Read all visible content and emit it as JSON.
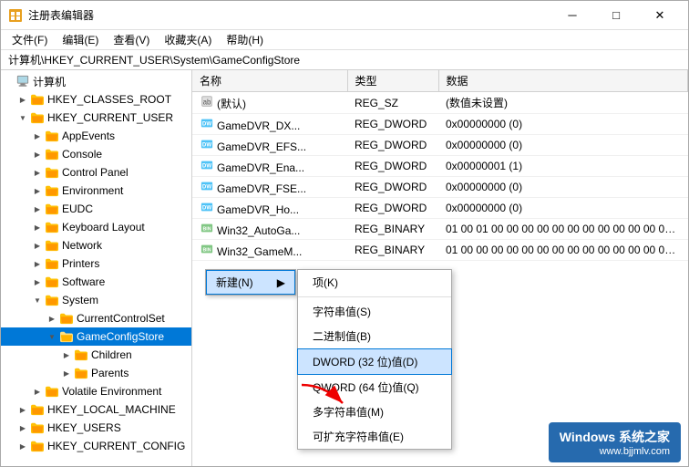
{
  "window": {
    "title": "注册表编辑器",
    "title_icon": "regedit"
  },
  "title_controls": {
    "minimize": "─",
    "maximize": "□",
    "close": "✕"
  },
  "menu_bar": {
    "items": [
      "文件(F)",
      "编辑(E)",
      "查看(V)",
      "收藏夹(A)",
      "帮助(H)"
    ]
  },
  "address_bar": {
    "path": "计算机\\HKEY_CURRENT_USER\\System\\GameConfigStore"
  },
  "tree": {
    "items": [
      {
        "label": "计算机",
        "indent": 0,
        "expanded": true,
        "toggle": ""
      },
      {
        "label": "HKEY_CLASSES_ROOT",
        "indent": 1,
        "expanded": false,
        "toggle": "▶"
      },
      {
        "label": "HKEY_CURRENT_USER",
        "indent": 1,
        "expanded": true,
        "toggle": "▼"
      },
      {
        "label": "AppEvents",
        "indent": 2,
        "expanded": false,
        "toggle": "▶"
      },
      {
        "label": "Console",
        "indent": 2,
        "expanded": false,
        "toggle": "▶"
      },
      {
        "label": "Control Panel",
        "indent": 2,
        "expanded": false,
        "toggle": "▶"
      },
      {
        "label": "Environment",
        "indent": 2,
        "expanded": false,
        "toggle": "▶"
      },
      {
        "label": "EUDC",
        "indent": 2,
        "expanded": false,
        "toggle": "▶"
      },
      {
        "label": "Keyboard Layout",
        "indent": 2,
        "expanded": false,
        "toggle": "▶"
      },
      {
        "label": "Network",
        "indent": 2,
        "expanded": false,
        "toggle": "▶"
      },
      {
        "label": "Printers",
        "indent": 2,
        "expanded": false,
        "toggle": "▶"
      },
      {
        "label": "Software",
        "indent": 2,
        "expanded": false,
        "toggle": "▶"
      },
      {
        "label": "System",
        "indent": 2,
        "expanded": true,
        "toggle": "▼"
      },
      {
        "label": "CurrentControlSet",
        "indent": 3,
        "expanded": false,
        "toggle": "▶"
      },
      {
        "label": "GameConfigStore",
        "indent": 3,
        "expanded": true,
        "toggle": "▼",
        "selected": true
      },
      {
        "label": "Children",
        "indent": 4,
        "expanded": false,
        "toggle": "▶"
      },
      {
        "label": "Parents",
        "indent": 4,
        "expanded": false,
        "toggle": "▶"
      },
      {
        "label": "Volatile Environment",
        "indent": 2,
        "expanded": false,
        "toggle": "▶"
      },
      {
        "label": "HKEY_LOCAL_MACHINE",
        "indent": 1,
        "expanded": false,
        "toggle": "▶"
      },
      {
        "label": "HKEY_USERS",
        "indent": 1,
        "expanded": false,
        "toggle": "▶"
      },
      {
        "label": "HKEY_CURRENT_CONFIG",
        "indent": 1,
        "expanded": false,
        "toggle": "▶"
      }
    ]
  },
  "table": {
    "columns": [
      "名称",
      "类型",
      "数据"
    ],
    "rows": [
      {
        "name": "(默认)",
        "icon": "default",
        "type": "REG_SZ",
        "data": "(数值未设置)"
      },
      {
        "name": "GameDVR_DX...",
        "icon": "dword",
        "type": "REG_DWORD",
        "data": "0x00000000 (0)"
      },
      {
        "name": "GameDVR_EFS...",
        "icon": "dword",
        "type": "REG_DWORD",
        "data": "0x00000000 (0)"
      },
      {
        "name": "GameDVR_Ena...",
        "icon": "dword",
        "type": "REG_DWORD",
        "data": "0x00000001 (1)"
      },
      {
        "name": "GameDVR_FSE...",
        "icon": "dword",
        "type": "REG_DWORD",
        "data": "0x00000000 (0)"
      },
      {
        "name": "GameDVR_Ho...",
        "icon": "dword",
        "type": "REG_DWORD",
        "data": "0x00000000 (0)"
      },
      {
        "name": "Win32_AutoGa...",
        "icon": "binary",
        "type": "REG_BINARY",
        "data": "01 00 01 00 00 00 00 00 00 00 00 00 00 00 00 00..."
      },
      {
        "name": "Win32_GameM...",
        "icon": "binary",
        "type": "REG_BINARY",
        "data": "01 00 00 00 00 00 00 00 00 00 00 00 00 00 00 00..."
      }
    ]
  },
  "context_menu": {
    "new_label": "新建(N)",
    "arrow": "▶",
    "submenu_items": [
      {
        "label": "项(K)",
        "highlighted": false
      },
      {
        "label": "",
        "separator": true
      },
      {
        "label": "字符串值(S)",
        "highlighted": false
      },
      {
        "label": "二进制值(B)",
        "highlighted": false
      },
      {
        "label": "DWORD (32 位)值(D)",
        "highlighted": true
      },
      {
        "label": "QWORD (64 位)值(Q)",
        "highlighted": false
      },
      {
        "label": "多字符串值(M)",
        "highlighted": false
      },
      {
        "label": "可扩充字符串值(E)",
        "highlighted": false
      }
    ]
  },
  "watermark": {
    "title": "Windows 系统之家",
    "url": "www.bjjmlv.com"
  }
}
